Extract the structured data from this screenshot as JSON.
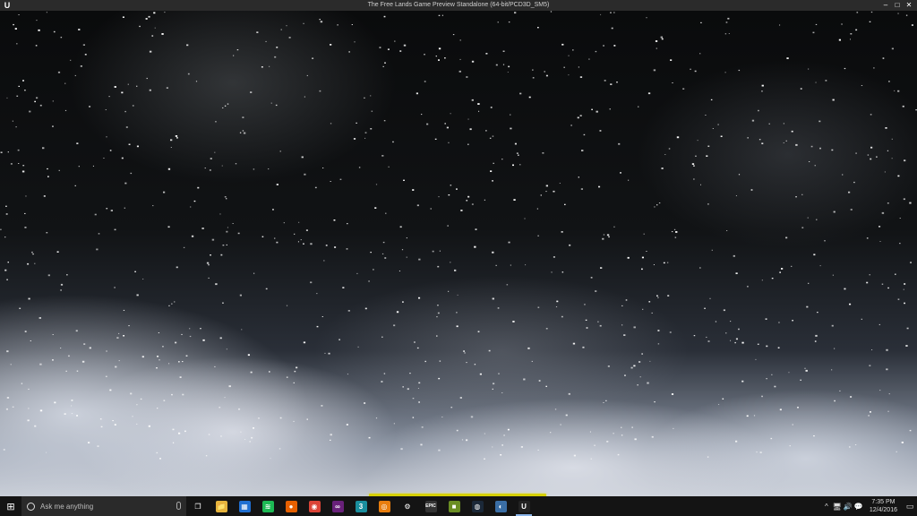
{
  "window": {
    "title": "The Free Lands Game Preview Standalone (64-bit/PCD3D_SM5)",
    "app_logo": "U",
    "controls": {
      "minimize": "–",
      "maximize": "□",
      "close": "✕"
    }
  },
  "game": {
    "loading_progress": 1.0,
    "loading_bar_color": "#d6d000"
  },
  "taskbar": {
    "start_glyph": "⊞",
    "search_placeholder": "Ask me anything",
    "pinned": [
      {
        "name": "task-view-icon",
        "glyph": "❐",
        "color": "transparent"
      },
      {
        "name": "file-explorer-icon",
        "glyph": "📁",
        "color": "#e7b43c"
      },
      {
        "name": "store-icon",
        "glyph": "▦",
        "color": "#1f6fd1"
      },
      {
        "name": "spotify-icon",
        "glyph": "≋",
        "color": "#1db954"
      },
      {
        "name": "firefox-icon",
        "glyph": "●",
        "color": "#e66000"
      },
      {
        "name": "chrome-icon",
        "glyph": "◉",
        "color": "#db4437"
      },
      {
        "name": "visual-studio-icon",
        "glyph": "∞",
        "color": "#68217a"
      },
      {
        "name": "3ds-max-icon",
        "glyph": "3",
        "color": "#1a8e9e"
      },
      {
        "name": "blender-icon",
        "glyph": "◎",
        "color": "#e87d0d"
      },
      {
        "name": "settings-icon",
        "glyph": "⚙",
        "color": "transparent"
      },
      {
        "name": "epic-games-icon",
        "glyph": "EPIC",
        "color": "#333333"
      },
      {
        "name": "minecraft-icon",
        "glyph": "■",
        "color": "#6b8e23"
      },
      {
        "name": "steam-icon",
        "glyph": "◍",
        "color": "#1b2838"
      },
      {
        "name": "paint-net-icon",
        "glyph": "◐",
        "color": "#3a6ea5"
      },
      {
        "name": "unreal-engine-icon",
        "glyph": "U",
        "color": "#222222"
      }
    ],
    "active_index": 14,
    "tray": {
      "chevron": "^",
      "icons": [
        "🖥",
        "🔊",
        "💬"
      ],
      "time": "7:35 PM",
      "date": "12/4/2016",
      "notification_glyph": "▭"
    }
  }
}
